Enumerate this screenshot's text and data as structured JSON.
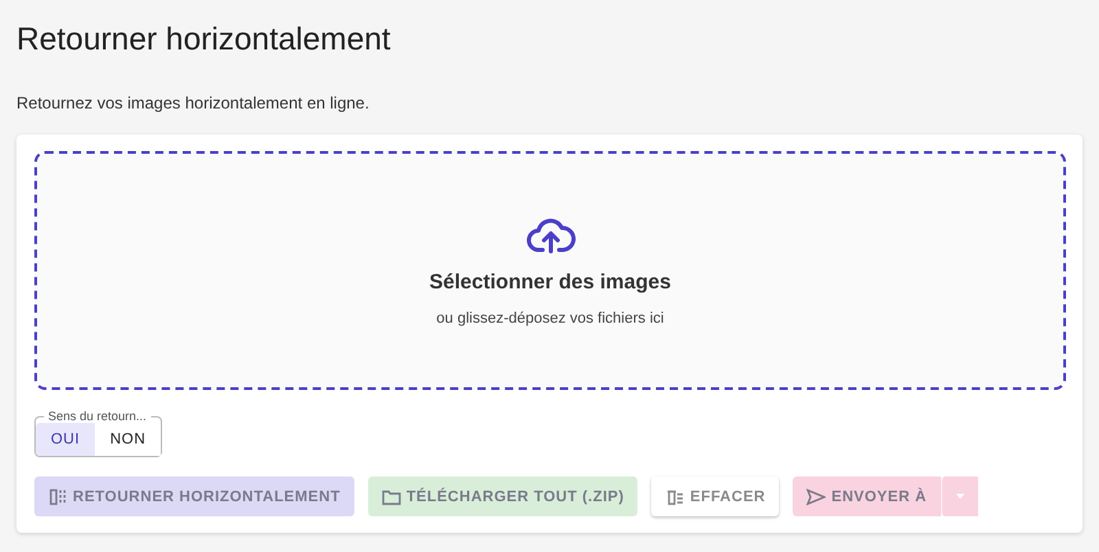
{
  "title": "Retourner horizontalement",
  "subtitle": "Retournez vos images horizontalement en ligne.",
  "dropzone": {
    "heading": "Sélectionner des images",
    "hint": "ou glissez-déposez vos fichiers ici"
  },
  "toggle": {
    "legend": "Sens du retourn...",
    "options": [
      {
        "label": "OUI",
        "selected": true
      },
      {
        "label": "NON",
        "selected": false
      }
    ]
  },
  "buttons": [
    {
      "label": "RETOURNER HORIZONTALEMENT",
      "kind": "flip",
      "color": "#dcd9f6",
      "disabled": true
    },
    {
      "label": "TÉLÉCHARGER TOUT (.ZIP)",
      "kind": "download",
      "color": "#d9eed9",
      "disabled": true
    },
    {
      "label": "EFFACER",
      "kind": "clear",
      "color": "#ffffff",
      "disabled": true
    },
    {
      "label": "ENVOYER À",
      "kind": "send",
      "color": "#f9d3df",
      "disabled": true
    }
  ]
}
